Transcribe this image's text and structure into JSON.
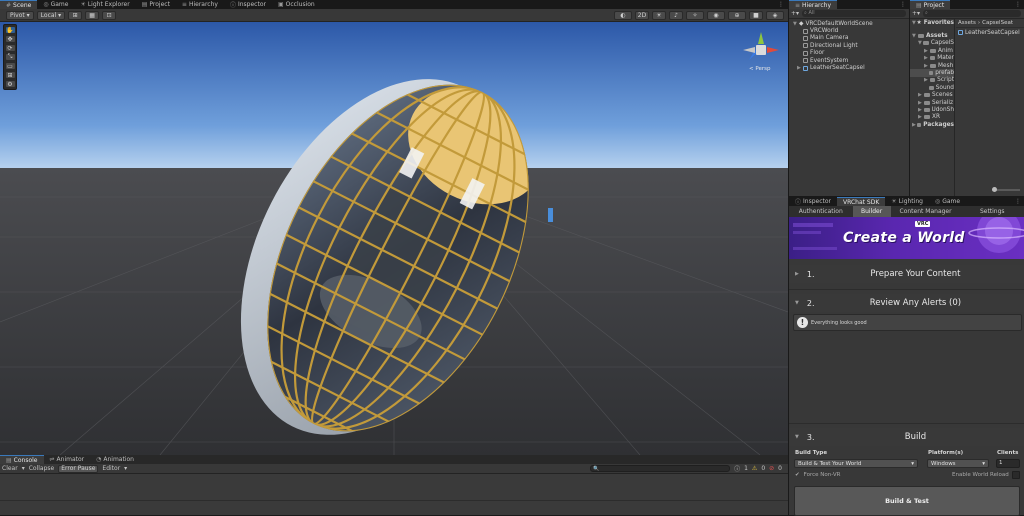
{
  "scene_tabs": [
    "Scene",
    "Game",
    "Light Explorer",
    "Project",
    "Hierarchy",
    "Inspector",
    "Occlusion"
  ],
  "scene_toolbar": {
    "pivot": "Pivot",
    "space": "Local"
  },
  "scene_view": {
    "persp_label": "< Persp"
  },
  "hierarchy": {
    "tab": "Hierarchy",
    "search_placeholder": "All",
    "scene_name": "VRCDefaultWorldScene",
    "objects": [
      "VRCWorld",
      "Main Camera",
      "Directional Light",
      "Floor",
      "EventSystem",
      "LeatherSeatCapsel"
    ]
  },
  "project": {
    "tab": "Project",
    "favorites": "Favorites",
    "assets": "Assets",
    "folders": [
      "CapselS",
      "Anim",
      "Mater",
      "Mesh",
      "prefab",
      "Script",
      "Sound",
      "Scenes",
      "Serializ",
      "UdonSh",
      "XR"
    ],
    "packages": "Packages",
    "breadcrumb": [
      "Assets",
      "CapselSeat"
    ],
    "asset_item": "LeatherSeatCapsel"
  },
  "inspector_tabs": [
    "Inspector",
    "VRChat SDK",
    "Lighting",
    "Game"
  ],
  "sdk": {
    "nav": [
      "Authentication",
      "Builder",
      "Content Manager",
      "Settings"
    ],
    "banner_badge": "VRC",
    "banner_title": "Create a World",
    "sections": [
      {
        "num": "1.",
        "title": "Prepare Your Content"
      },
      {
        "num": "2.",
        "title": "Review Any Alerts (0)"
      },
      {
        "num": "3.",
        "title": "Build"
      }
    ],
    "alert_text": "Everything looks good",
    "build_type_label": "Build Type",
    "build_type_value": "Build & Test Your World",
    "platforms_label": "Platform(s)",
    "platform_value": "Windows",
    "clients_label": "Clients",
    "clients_value": "1",
    "force_non_vr": "Force Non-VR",
    "enable_world_reload": "Enable World Reload",
    "build_button": "Build & Test"
  },
  "console": {
    "tabs": [
      "Console",
      "Animator",
      "Animation"
    ],
    "buttons": [
      "Clear",
      "Collapse",
      "Error Pause",
      "Editor"
    ],
    "counts": [
      "1",
      "0",
      "0"
    ]
  },
  "colors": {
    "accent": "#3a79bb",
    "sky_top": "#2c58a8",
    "sky_horizon": "#9fc3ec",
    "ground": "#3b3c3f",
    "banner_purple": "#5a27b0",
    "gold": "#c29a3a"
  }
}
